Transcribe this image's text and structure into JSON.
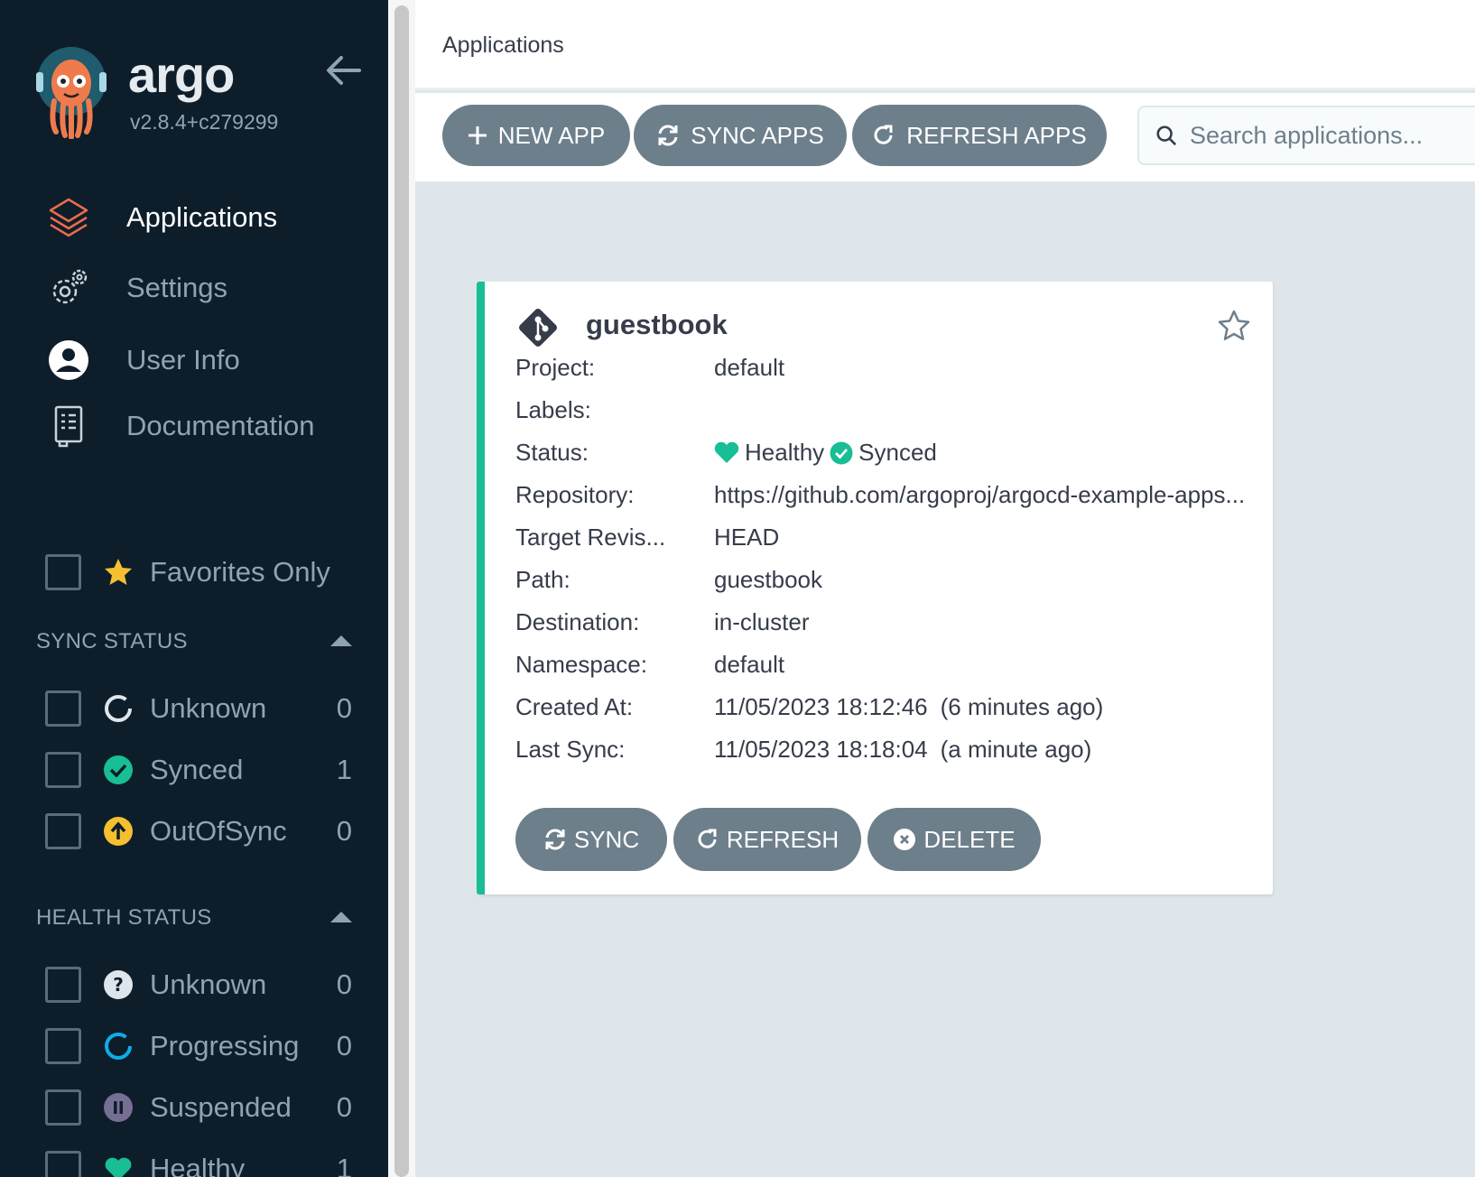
{
  "sidebar": {
    "brand": "argo",
    "version": "v2.8.4+c279299",
    "nav": [
      {
        "label": "Applications"
      },
      {
        "label": "Settings"
      },
      {
        "label": "User Info"
      },
      {
        "label": "Documentation"
      }
    ],
    "favorites_label": "Favorites Only",
    "sync_status": {
      "title": "SYNC STATUS",
      "items": [
        {
          "label": "Unknown",
          "count": "0"
        },
        {
          "label": "Synced",
          "count": "1"
        },
        {
          "label": "OutOfSync",
          "count": "0"
        }
      ]
    },
    "health_status": {
      "title": "HEALTH STATUS",
      "items": [
        {
          "label": "Unknown",
          "count": "0"
        },
        {
          "label": "Progressing",
          "count": "0"
        },
        {
          "label": "Suspended",
          "count": "0"
        },
        {
          "label": "Healthy",
          "count": "1"
        }
      ]
    }
  },
  "header": {
    "title": "Applications"
  },
  "toolbar": {
    "new_app": "NEW APP",
    "sync_apps": "SYNC APPS",
    "refresh_apps": "REFRESH APPS",
    "search_placeholder": "Search applications..."
  },
  "app": {
    "name": "guestbook",
    "fields": {
      "project": {
        "key": "Project:",
        "value": "default"
      },
      "labels": {
        "key": "Labels:",
        "value": ""
      },
      "status": {
        "key": "Status:",
        "health": "Healthy",
        "sync": "Synced"
      },
      "repository": {
        "key": "Repository:",
        "value": "https://github.com/argoproj/argocd-example-apps..."
      },
      "target_revision": {
        "key": "Target Revis...",
        "value": "HEAD"
      },
      "path": {
        "key": "Path:",
        "value": "guestbook"
      },
      "destination": {
        "key": "Destination:",
        "value": "in-cluster"
      },
      "namespace": {
        "key": "Namespace:",
        "value": "default"
      },
      "created_at": {
        "key": "Created At:",
        "value": "11/05/2023 18:12:46",
        "relative": "(6 minutes ago)"
      },
      "last_sync": {
        "key": "Last Sync:",
        "value": "11/05/2023 18:18:04",
        "relative": "(a minute ago)"
      }
    },
    "actions": {
      "sync": "SYNC",
      "refresh": "REFRESH",
      "delete": "DELETE"
    }
  },
  "colors": {
    "sidebar_bg": "#0e1d2a",
    "accent_orange": "#e96d76",
    "healthy_green": "#18be94",
    "outofsync_yellow": "#f4c030",
    "progressing_blue": "#0dadea",
    "suspended_purple": "#766f94",
    "button_gray": "#6d7f8b"
  }
}
